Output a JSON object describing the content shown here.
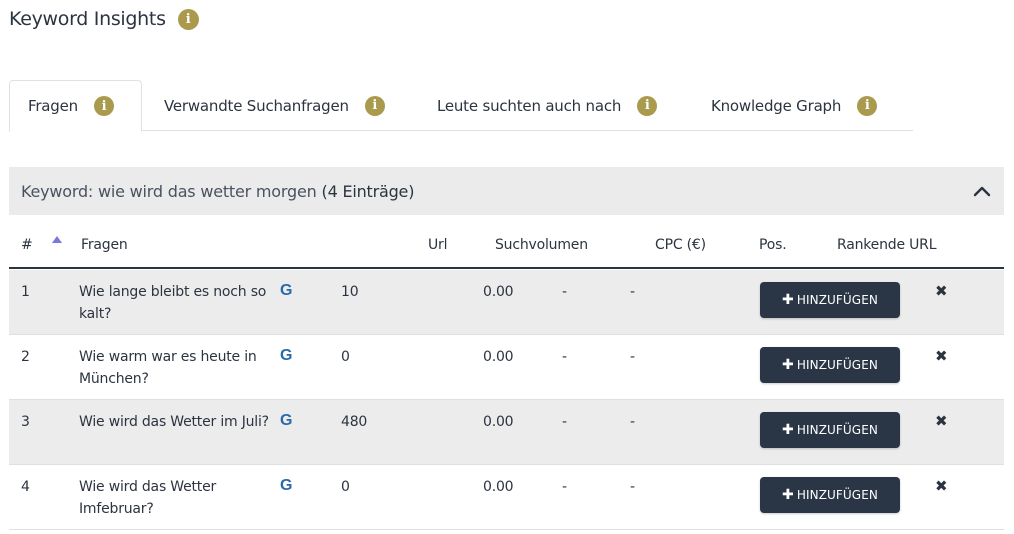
{
  "header": {
    "title": "Keyword Insights",
    "info_icon": "i"
  },
  "tabs": [
    {
      "label": "Fragen",
      "active": true
    },
    {
      "label": "Verwandte Suchanfragen",
      "active": false
    },
    {
      "label": "Leute suchten auch nach",
      "active": false
    },
    {
      "label": "Knowledge Graph",
      "active": false
    }
  ],
  "panel": {
    "keyword_label": "Keyword: wie wird das wetter morgen",
    "count_label": "(4 Einträge)",
    "collapse_icon": "chevron-up"
  },
  "table": {
    "columns": [
      "#",
      "Fragen",
      "Url",
      "Suchvolumen",
      "CPC (€)",
      "Pos.",
      "Rankende URL"
    ],
    "sort_indicator": "▲",
    "google_icon": "G",
    "add_button_label": "HINZUFÜGEN",
    "add_button_icon": "✚",
    "delete_icon": "✖",
    "rows": [
      {
        "num": "1",
        "question": "Wie lange bleibt es noch so kalt?",
        "volume": "10",
        "cpc": "0.00",
        "pos": "-",
        "ranking_url": "-"
      },
      {
        "num": "2",
        "question": "Wie warm war es heute in München?",
        "volume": "0",
        "cpc": "0.00",
        "pos": "-",
        "ranking_url": "-"
      },
      {
        "num": "3",
        "question": "Wie wird das Wetter im Juli?",
        "volume": "480",
        "cpc": "0.00",
        "pos": "-",
        "ranking_url": "-"
      },
      {
        "num": "4",
        "question": "Wie wird das Wetter Imfebruar?",
        "volume": "0",
        "cpc": "0.00",
        "pos": "-",
        "ranking_url": "-"
      }
    ]
  },
  "colors": {
    "info_icon": "#a99a4e",
    "button_bg": "#2a3646",
    "google_icon": "#2a6aa8",
    "sort_indicator": "#7a78d8",
    "row_stripe": "#ececec"
  }
}
